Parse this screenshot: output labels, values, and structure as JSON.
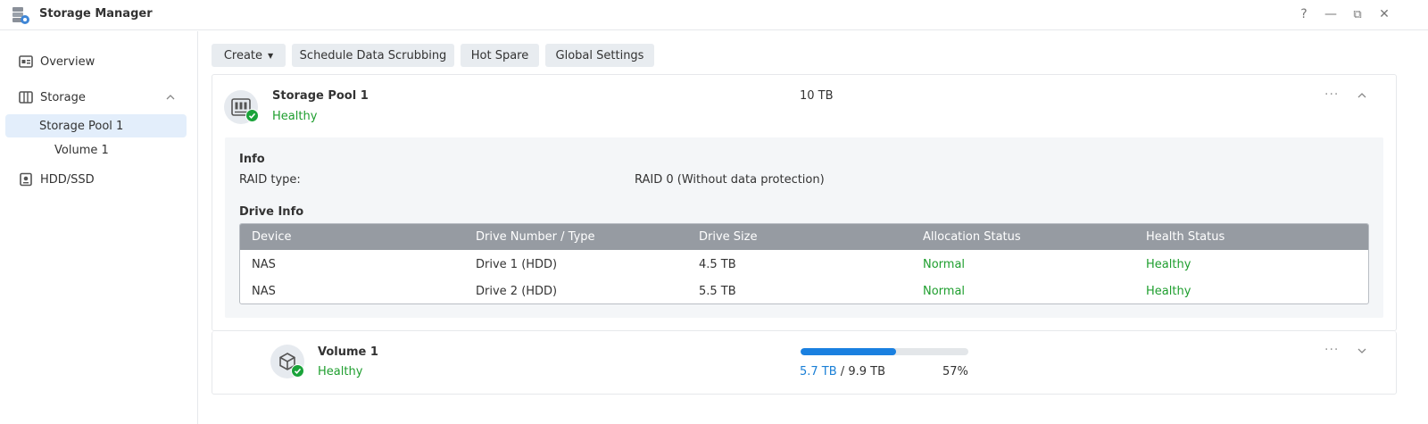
{
  "window": {
    "title": "Storage Manager",
    "controls": [
      "?",
      "—",
      "⧉",
      "✕"
    ]
  },
  "sidebar": {
    "overview": "Overview",
    "storage": "Storage",
    "storage_pool_1": "Storage Pool 1",
    "volume_1": "Volume 1",
    "hdd_ssd": "HDD/SSD"
  },
  "toolbar": {
    "create": "Create",
    "schedule": "Schedule Data Scrubbing",
    "hot_spare": "Hot Spare",
    "global_settings": "Global Settings"
  },
  "pool": {
    "name": "Storage Pool 1",
    "status": "Healthy",
    "size": "10 TB",
    "more": "···",
    "info_heading": "Info",
    "raid_label": "RAID type:",
    "raid_value": "RAID 0 (Without data protection)",
    "drive_info_heading": "Drive Info",
    "columns": [
      "Device",
      "Drive Number / Type",
      "Drive Size",
      "Allocation Status",
      "Health Status"
    ],
    "drives": [
      [
        "NAS",
        "Drive 1 (HDD)",
        "4.5 TB",
        "Normal",
        "Healthy"
      ],
      [
        "NAS",
        "Drive 2 (HDD)",
        "5.5 TB",
        "Normal",
        "Healthy"
      ]
    ]
  },
  "volume": {
    "name": "Volume 1",
    "status": "Healthy",
    "used": "5.7 TB",
    "separator": " / ",
    "total": "9.9 TB",
    "percent": "57%",
    "usage_fraction": 0.57,
    "more": "···"
  },
  "colors": {
    "healthy": "#1e9e2e",
    "accent": "#1a80e0",
    "table_header": "#969ba2"
  }
}
